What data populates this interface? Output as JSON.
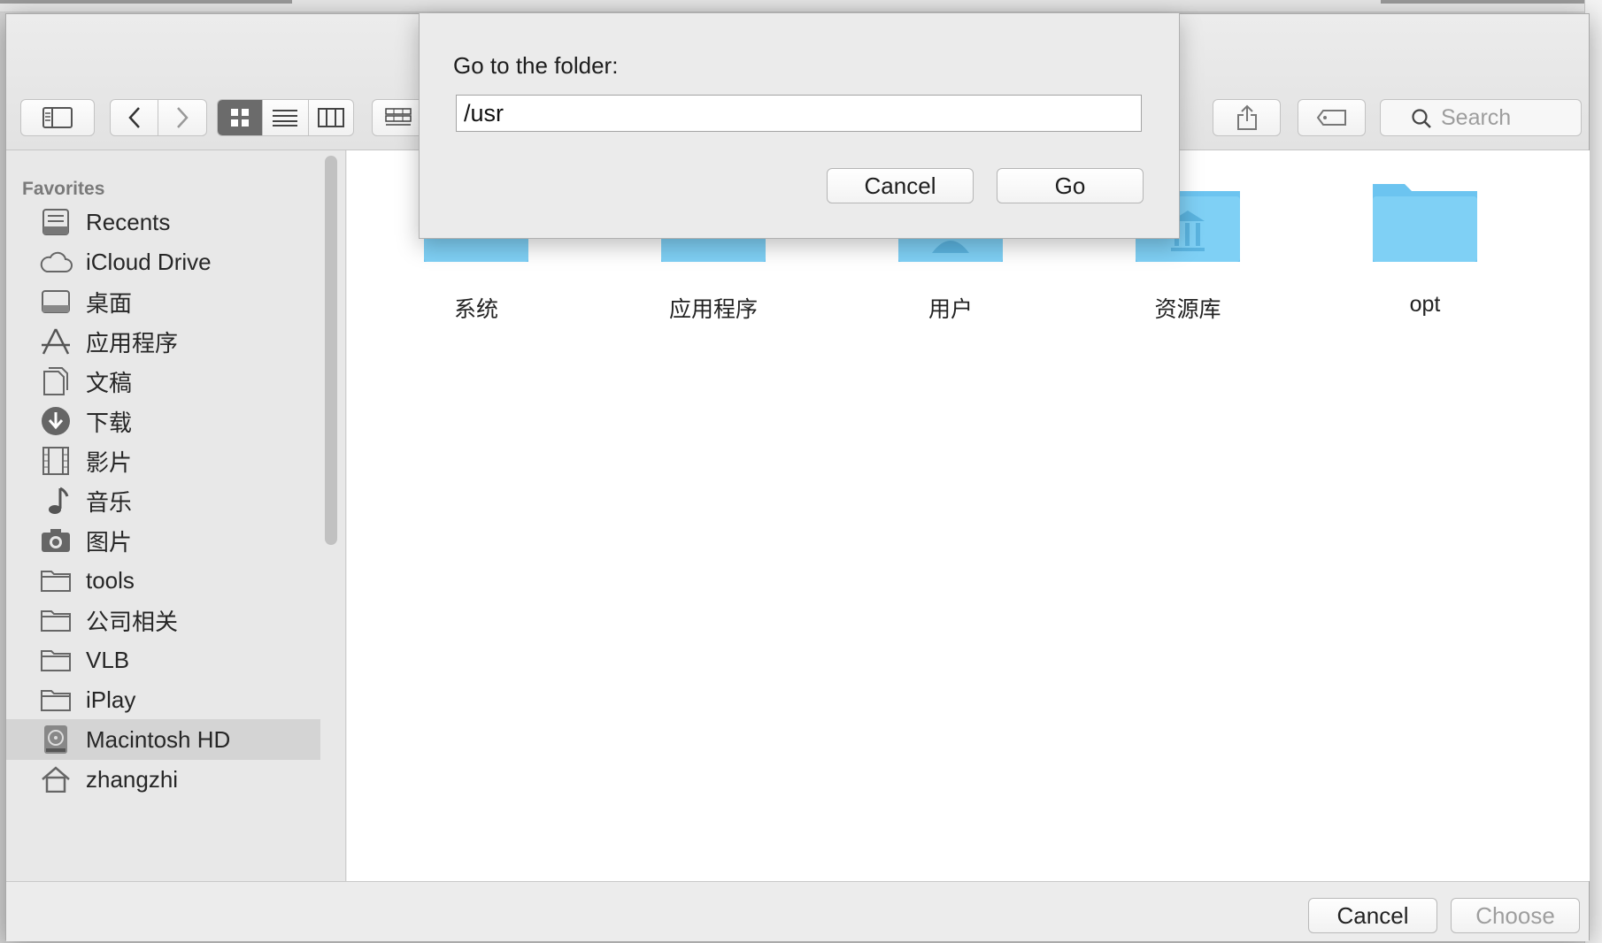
{
  "toolbar": {
    "search_placeholder": "Search"
  },
  "sidebar": {
    "heading": "Favorites",
    "items": [
      {
        "label": "Recents",
        "icon": "recents-icon"
      },
      {
        "label": "iCloud Drive",
        "icon": "cloud-icon"
      },
      {
        "label": "桌面",
        "icon": "desktop-icon"
      },
      {
        "label": "应用程序",
        "icon": "applications-icon"
      },
      {
        "label": "文稿",
        "icon": "documents-icon"
      },
      {
        "label": "下载",
        "icon": "downloads-icon"
      },
      {
        "label": "影片",
        "icon": "movies-icon"
      },
      {
        "label": "音乐",
        "icon": "music-icon"
      },
      {
        "label": "图片",
        "icon": "pictures-icon"
      },
      {
        "label": "tools",
        "icon": "folder-icon"
      },
      {
        "label": "公司相关",
        "icon": "folder-icon"
      },
      {
        "label": "VLB",
        "icon": "folder-icon"
      },
      {
        "label": "iPlay",
        "icon": "folder-icon"
      },
      {
        "label": "Macintosh HD",
        "icon": "hard-drive-icon",
        "selected": true
      },
      {
        "label": "zhangzhi",
        "icon": "home-icon"
      }
    ]
  },
  "content": {
    "folders": [
      {
        "label": "系统",
        "icon": "system-folder-icon"
      },
      {
        "label": "应用程序",
        "icon": "applications-folder-icon"
      },
      {
        "label": "用户",
        "icon": "users-folder-icon"
      },
      {
        "label": "资源库",
        "icon": "library-folder-icon"
      },
      {
        "label": "opt",
        "icon": "folder-icon"
      }
    ]
  },
  "bottom": {
    "cancel_label": "Cancel",
    "choose_label": "Choose"
  },
  "goto_sheet": {
    "title": "Go to the folder:",
    "path_value": "/usr",
    "cancel_label": "Cancel",
    "go_label": "Go"
  },
  "colors": {
    "folder_blue": "#6cc4f0",
    "selection_gray": "#d4d4d4"
  }
}
